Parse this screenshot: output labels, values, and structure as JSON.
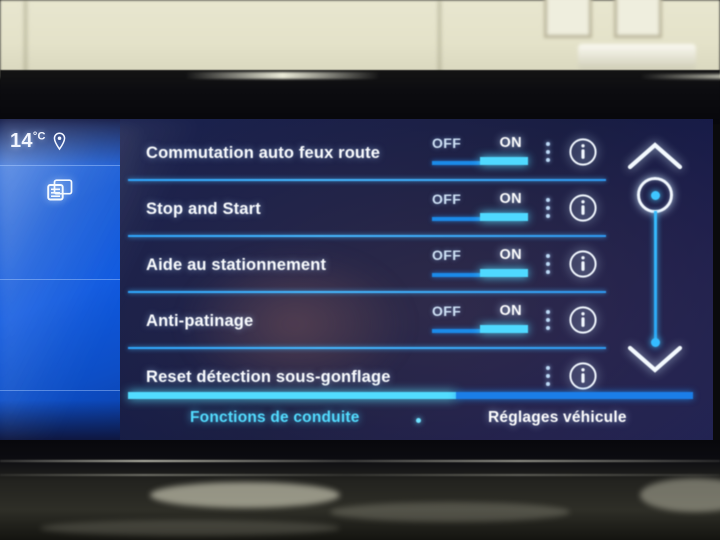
{
  "status": {
    "temperature": "14",
    "temperature_unit": "°C",
    "location_icon": "location-pin-icon"
  },
  "sidebar": {
    "active_tile_icon": "stacked-cards-icon"
  },
  "settings_list": {
    "rows": [
      {
        "label": "Commutation auto feux route",
        "has_toggle": true,
        "off_label": "OFF",
        "on_label": "ON",
        "state": "ON",
        "menu_icon": "vertical-dots-icon",
        "info_icon": "info-circle-icon"
      },
      {
        "label": "Stop and Start",
        "has_toggle": true,
        "off_label": "OFF",
        "on_label": "ON",
        "state": "ON",
        "menu_icon": "vertical-dots-icon",
        "info_icon": "info-circle-icon"
      },
      {
        "label": "Aide au stationnement",
        "has_toggle": true,
        "off_label": "OFF",
        "on_label": "ON",
        "state": "ON",
        "menu_icon": "vertical-dots-icon",
        "info_icon": "info-circle-icon"
      },
      {
        "label": "Anti-patinage",
        "has_toggle": true,
        "off_label": "OFF",
        "on_label": "ON",
        "state": "ON",
        "menu_icon": "vertical-dots-icon",
        "info_icon": "info-circle-icon"
      },
      {
        "label": "Reset détection sous-gonflage",
        "has_toggle": false,
        "menu_icon": "vertical-dots-icon",
        "info_icon": "info-circle-icon"
      }
    ]
  },
  "scrollbar": {
    "up_icon": "chevron-up-icon",
    "down_icon": "chevron-down-icon",
    "thumb_position": "top"
  },
  "tabbar": {
    "tabs": [
      {
        "label": "Fonctions de conduite",
        "active": true
      },
      {
        "label": "Réglages véhicule",
        "active": false
      }
    ]
  },
  "colors": {
    "accent_cyan": "#4fd9ff",
    "accent_blue": "#1b7ee8",
    "rail_blue": "#1157d6",
    "screen_bg": "#131c48",
    "text_white": "#fbfdff"
  }
}
